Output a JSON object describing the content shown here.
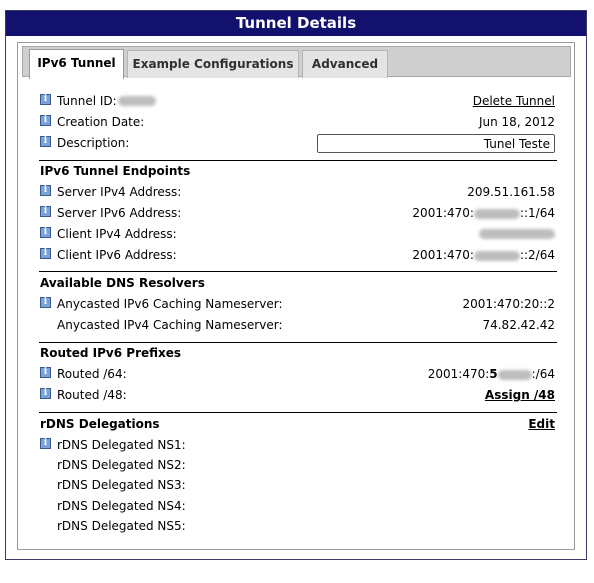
{
  "panel": {
    "title": "Tunnel Details"
  },
  "tabs": [
    {
      "label": "IPv6 Tunnel",
      "active": true
    },
    {
      "label": "Example Configurations",
      "active": false
    },
    {
      "label": "Advanced",
      "active": false
    }
  ],
  "tunnel": {
    "tunnel_id_label": "Tunnel ID:",
    "delete_label": "Delete Tunnel",
    "creation_label": "Creation Date:",
    "creation_value": "Jun 18, 2012",
    "description_label": "Description:",
    "description_value": "Tunel Teste"
  },
  "endpoints": {
    "heading": "IPv6 Tunnel Endpoints",
    "server_ipv4_label": "Server IPv4 Address:",
    "server_ipv4_value": "209.51.161.58",
    "server_ipv6_label": "Server IPv6 Address:",
    "server_ipv6_prefix": "2001:470:",
    "server_ipv6_suffix": "::1/64",
    "client_ipv4_label": "Client IPv4 Address:",
    "client_ipv6_label": "Client IPv6 Address:",
    "client_ipv6_prefix": "2001:470:",
    "client_ipv6_suffix": "::2/64"
  },
  "dns": {
    "heading": "Available DNS Resolvers",
    "ipv6_label": "Anycasted IPv6 Caching Nameserver:",
    "ipv6_value": "2001:470:20::2",
    "ipv4_label": "Anycasted IPv4 Caching Nameserver:",
    "ipv4_value": "74.82.42.42"
  },
  "routed": {
    "heading": "Routed IPv6 Prefixes",
    "r64_label": "Routed /64:",
    "r64_prefix": "2001:470:",
    "r64_bold": "5",
    "r64_suffix": ":/64",
    "r48_label": "Routed /48:",
    "r48_link": "Assign /48"
  },
  "rdns": {
    "heading": "rDNS Delegations",
    "edit_label": "Edit",
    "ns": [
      "rDNS Delegated NS1:",
      "rDNS Delegated NS2:",
      "rDNS Delegated NS3:",
      "rDNS Delegated NS4:",
      "rDNS Delegated NS5:"
    ]
  },
  "icons": {
    "info": "info-icon",
    "info_glyph": "i"
  }
}
